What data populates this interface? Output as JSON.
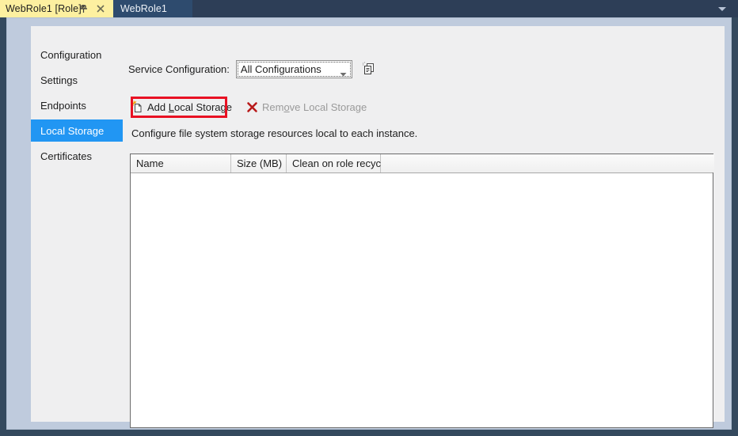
{
  "tabs": [
    {
      "label": "WebRole1 [Role]*",
      "active": true,
      "pin_icon": "pin-icon",
      "close_icon": "close-icon"
    },
    {
      "label": "WebRole1",
      "active": false
    }
  ],
  "tabstrip": {
    "overflow_icon": "chevron-down-icon"
  },
  "sidebar": {
    "items": [
      {
        "label": "Configuration",
        "selected": false
      },
      {
        "label": "Settings",
        "selected": false
      },
      {
        "label": "Endpoints",
        "selected": false
      },
      {
        "label": "Local Storage",
        "selected": true
      },
      {
        "label": "Certificates",
        "selected": false
      }
    ]
  },
  "service_configuration": {
    "label": "Service Configuration:",
    "selected_value": "All Configurations",
    "options": [
      "All Configurations"
    ],
    "dropdown_icon": "chevron-down-icon",
    "copy_icon": "copy-configuration-icon"
  },
  "toolbar": {
    "add": {
      "label_before": "Add ",
      "label_mnemonic": "L",
      "label_after": "ocal Storage",
      "full_label": "Add Local Storage",
      "icon": "add-local-storage-icon",
      "enabled": true
    },
    "remove": {
      "label_before": "Rem",
      "label_mnemonic": "o",
      "label_after": "ve Local Storage",
      "full_label": "Remove Local Storage",
      "icon": "remove-x-icon",
      "enabled": false
    }
  },
  "description": "Configure file system storage resources local to each instance.",
  "grid": {
    "columns": [
      "Name",
      "Size (MB)",
      "Clean on role recycle",
      ""
    ],
    "rows": []
  },
  "annotation": {
    "target": "Add Local Storage",
    "color": "#e81123"
  },
  "colors": {
    "accent_selected": "#2196f3",
    "active_tab": "#fdf0a0",
    "inactive_tab": "#2e4b6e",
    "window_chrome": "#34495e",
    "panel": "#efeff0",
    "annotation_red": "#e81123"
  }
}
